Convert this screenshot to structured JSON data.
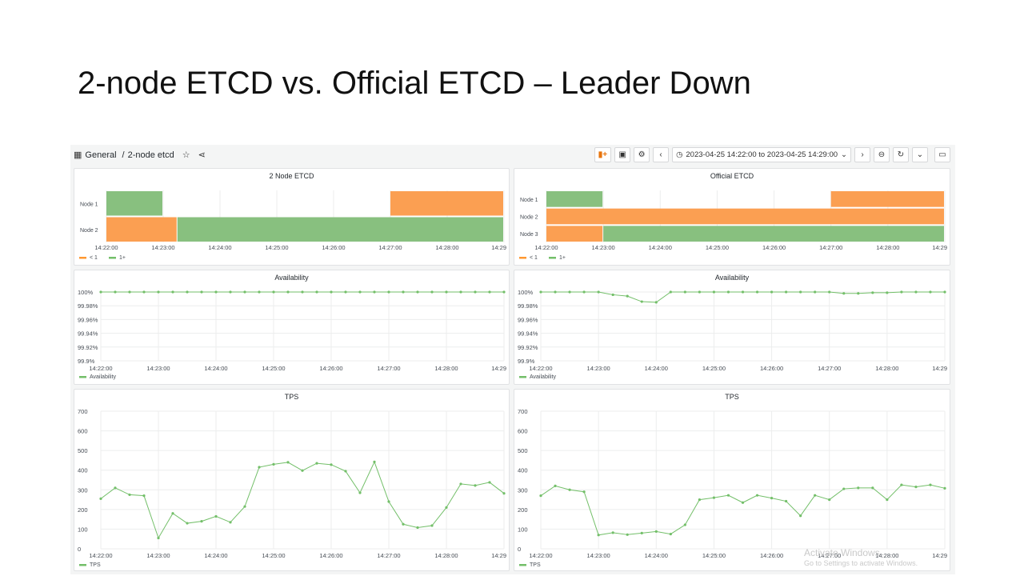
{
  "slide": {
    "title": "2-node ETCD vs. Official ETCD – Leader Down"
  },
  "breadcrumb": {
    "root": "General",
    "separator": "/",
    "dashboard": "2-node etcd"
  },
  "toolbar": {
    "time_range": "2023-04-25 14:22:00 to 2023-04-25 14:29:00",
    "icons": [
      "add-panel-icon",
      "save-icon",
      "gear-icon",
      "chevron-left-icon",
      "clock-icon",
      "chevron-down-icon",
      "chevron-right-icon",
      "zoom-out-icon",
      "refresh-icon",
      "chevron-down-icon",
      "tv-icon",
      "star-icon",
      "share-icon",
      "grid-icon"
    ]
  },
  "colors": {
    "green": "#73bf69",
    "green_fill": "#88c07f",
    "orange": "#ff9830",
    "orange_fill": "#fb9f52",
    "grid": "#eceded"
  },
  "x_ticks": [
    "14:22:00",
    "14:23:00",
    "14:24:00",
    "14:25:00",
    "14:26:00",
    "14:27:00",
    "14:28:00",
    "14:29"
  ],
  "state_legend": {
    "low": "< 1",
    "high": "1+"
  },
  "panels": {
    "state_left": {
      "title": "2 Node ETCD",
      "rows": [
        {
          "label": "Node 1",
          "segments": [
            {
              "state": "1+",
              "start": 0,
              "end": 1.0
            },
            {
              "state": "none",
              "start": 1.0,
              "end": 5.0
            },
            {
              "state": "< 1",
              "start": 5.0,
              "end": 7.0
            }
          ]
        },
        {
          "label": "Node 2",
          "segments": [
            {
              "state": "< 1",
              "start": 0,
              "end": 1.25
            },
            {
              "state": "1+",
              "start": 1.25,
              "end": 7.0
            }
          ]
        }
      ]
    },
    "state_right": {
      "title": "Official ETCD",
      "rows": [
        {
          "label": "Node 1",
          "segments": [
            {
              "state": "1+",
              "start": 0,
              "end": 1.0
            },
            {
              "state": "none",
              "start": 1.0,
              "end": 5.0
            },
            {
              "state": "< 1",
              "start": 5.0,
              "end": 7.0
            }
          ]
        },
        {
          "label": "Node 2",
          "segments": [
            {
              "state": "< 1",
              "start": 0,
              "end": 7.0
            }
          ]
        },
        {
          "label": "Node 3",
          "segments": [
            {
              "state": "< 1",
              "start": 0,
              "end": 1.0
            },
            {
              "state": "1+",
              "start": 1.0,
              "end": 7.0
            }
          ]
        }
      ]
    },
    "avail_left": {
      "title": "Availability",
      "legend": "Availability",
      "y_ticks": [
        "100%",
        "99.98%",
        "99.96%",
        "99.94%",
        "99.92%",
        "99.9%"
      ],
      "ylim": [
        99.9,
        100
      ]
    },
    "avail_right": {
      "title": "Availability",
      "legend": "Availability",
      "y_ticks": [
        "100%",
        "99.98%",
        "99.96%",
        "99.94%",
        "99.92%",
        "99.9%"
      ],
      "ylim": [
        99.9,
        100
      ]
    },
    "tps_left": {
      "title": "TPS",
      "legend": "TPS",
      "y_ticks": [
        "700",
        "600",
        "500",
        "400",
        "300",
        "200",
        "100",
        "0"
      ],
      "ylim": [
        0,
        700
      ]
    },
    "tps_right": {
      "title": "TPS",
      "legend": "TPS",
      "y_ticks": [
        "700",
        "600",
        "500",
        "400",
        "300",
        "200",
        "100",
        "0"
      ],
      "ylim": [
        0,
        700
      ]
    }
  },
  "chart_data": [
    {
      "type": "line",
      "title": "Availability",
      "x_minutes": [
        0,
        0.25,
        0.5,
        0.75,
        1,
        1.25,
        1.5,
        1.75,
        2,
        2.25,
        2.5,
        2.75,
        3,
        3.25,
        3.5,
        3.75,
        4,
        4.25,
        4.5,
        4.75,
        5,
        5.25,
        5.5,
        5.75,
        6,
        6.25,
        6.5,
        6.75,
        7
      ],
      "series": [
        {
          "name": "Availability",
          "values": [
            100,
            100,
            100,
            100,
            100,
            100,
            100,
            100,
            100,
            100,
            100,
            100,
            100,
            100,
            100,
            100,
            100,
            100,
            100,
            100,
            100,
            100,
            100,
            100,
            100,
            100,
            100,
            100,
            100
          ]
        }
      ],
      "ylim": [
        99.9,
        100
      ]
    },
    {
      "type": "line",
      "title": "Availability",
      "x_minutes": [
        0,
        0.25,
        0.5,
        0.75,
        1,
        1.25,
        1.5,
        1.75,
        2,
        2.25,
        2.5,
        2.75,
        3,
        3.25,
        3.5,
        3.75,
        4,
        4.25,
        4.5,
        4.75,
        5,
        5.25,
        5.5,
        5.75,
        6,
        6.25,
        6.5,
        6.75,
        7
      ],
      "series": [
        {
          "name": "Availability",
          "values": [
            100,
            100,
            100,
            100,
            100,
            99.996,
            99.994,
            99.986,
            99.985,
            100,
            100,
            100,
            100,
            100,
            100,
            100,
            100,
            100,
            100,
            100,
            100,
            99.998,
            99.998,
            99.999,
            99.999,
            100,
            100,
            100,
            100
          ]
        }
      ],
      "ylim": [
        99.9,
        100
      ]
    },
    {
      "type": "line",
      "title": "TPS",
      "x_minutes": [
        0,
        0.25,
        0.5,
        0.75,
        1,
        1.25,
        1.5,
        1.75,
        2,
        2.25,
        2.5,
        2.75,
        3,
        3.25,
        3.5,
        3.75,
        4,
        4.25,
        4.5,
        4.75,
        5,
        5.25,
        5.5,
        5.75,
        6,
        6.25,
        6.5,
        6.75,
        7
      ],
      "series": [
        {
          "name": "TPS",
          "values": [
            255,
            310,
            275,
            270,
            55,
            180,
            130,
            140,
            165,
            135,
            215,
            415,
            430,
            440,
            398,
            435,
            428,
            395,
            285,
            442,
            240,
            125,
            108,
            118,
            210,
            330,
            322,
            338,
            282
          ]
        }
      ],
      "ylim": [
        0,
        700
      ]
    },
    {
      "type": "line",
      "title": "TPS",
      "x_minutes": [
        0,
        0.25,
        0.5,
        0.75,
        1,
        1.25,
        1.5,
        1.75,
        2,
        2.25,
        2.5,
        2.75,
        3,
        3.25,
        3.5,
        3.75,
        4,
        4.25,
        4.5,
        4.75,
        5,
        5.25,
        5.5,
        5.75,
        6,
        6.25,
        6.5,
        6.75,
        7
      ],
      "series": [
        {
          "name": "TPS",
          "values": [
            270,
            320,
            300,
            290,
            70,
            82,
            72,
            80,
            88,
            75,
            122,
            250,
            260,
            272,
            235,
            272,
            258,
            242,
            168,
            272,
            250,
            305,
            310,
            310,
            250,
            325,
            315,
            325,
            308
          ]
        }
      ],
      "ylim": [
        0,
        700
      ]
    }
  ],
  "watermark": {
    "line1": "Activate Windows",
    "line2": "Go to Settings to activate Windows."
  }
}
